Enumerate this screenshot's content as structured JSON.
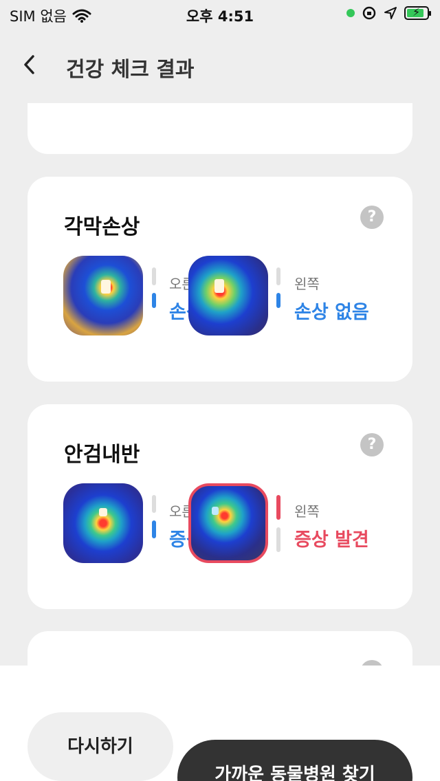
{
  "status_bar": {
    "carrier": "SIM 없음",
    "time": "오후 4:51"
  },
  "nav": {
    "title": "건강 체크 결과"
  },
  "cards": [
    {
      "title": "각막손상",
      "right": {
        "label": "오른쪽",
        "value": "손상 없음",
        "level": 0
      },
      "left": {
        "label": "왼쪽",
        "value": "손상 없음",
        "level": 0
      }
    },
    {
      "title": "안검내반",
      "right": {
        "label": "오른쪽",
        "value": "증상 없음",
        "level": 0
      },
      "left": {
        "label": "왼쪽",
        "value": "증상 발견",
        "level": 1
      }
    }
  ],
  "help_glyph": "?",
  "buttons": {
    "retry": "다시하기",
    "find_hospital": "가까운 동물병원 찾기"
  },
  "colors": {
    "normal": "#2e84e6",
    "alert": "#e84a5f"
  }
}
